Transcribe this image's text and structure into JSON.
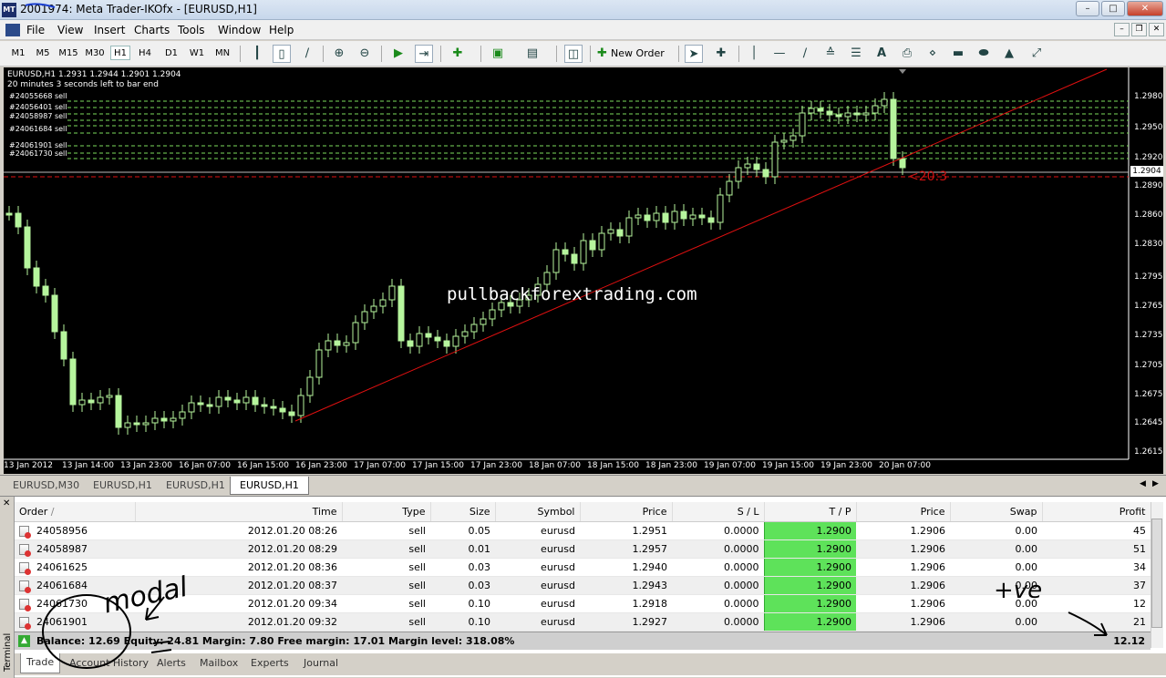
{
  "window": {
    "title": "2001974: Meta Trader-IKOfx - [EURUSD,H1]",
    "app_icon": "MT"
  },
  "menu": [
    "File",
    "View",
    "Insert",
    "Charts",
    "Tools",
    "Window",
    "Help"
  ],
  "toolbar": {
    "timeframes": [
      "M1",
      "M5",
      "M15",
      "M30",
      "H1",
      "H4",
      "D1",
      "W1",
      "MN"
    ],
    "active_timeframe": "H1",
    "new_order_label": "New Order",
    "icons": [
      "bar-chart-icon",
      "candle-chart-icon",
      "line-chart-icon",
      "zoom-in-icon",
      "zoom-out-icon",
      "autoscroll-icon",
      "chart-shift-icon",
      "indicators-icon",
      "templates-icon",
      "periods-icon",
      "navigator-icon",
      "new-order-icon",
      "cursor-icon",
      "crosshair-icon",
      "vertical-line-icon",
      "horizontal-line-icon",
      "trendline-icon",
      "channel-icon",
      "fibonacci-icon",
      "text-icon",
      "text-label-icon",
      "fibo-fan-icon",
      "rectangle-icon",
      "ellipse-icon",
      "triangle-icon",
      "arrows-icon"
    ]
  },
  "chart": {
    "info_line1": "EURUSD,H1  1.2931 1.2944 1.2901 1.2904",
    "info_line2": "20 minutes 3 seconds left to bar end",
    "order_labels": [
      "#24055668 sell",
      "#24056401 sell",
      "#24058987 sell",
      "#24061684 sell",
      "#24061901 sell",
      "#24061730 sell"
    ],
    "watermark": "pullbackforextrading.com",
    "cursor_label": "<20:3",
    "current_price": "1.2904",
    "price_ticks": [
      "1.2980",
      "1.2950",
      "1.2920",
      "1.2890",
      "1.2860",
      "1.2830",
      "1.2795",
      "1.2765",
      "1.2735",
      "1.2705",
      "1.2675",
      "1.2645",
      "1.2615"
    ],
    "time_ticks": [
      "13 Jan 2012",
      "13 Jan 14:00",
      "13 Jan 23:00",
      "16 Jan 07:00",
      "16 Jan 15:00",
      "16 Jan 23:00",
      "17 Jan 07:00",
      "17 Jan 15:00",
      "17 Jan 23:00",
      "18 Jan 07:00",
      "18 Jan 15:00",
      "18 Jan 23:00",
      "19 Jan 07:00",
      "19 Jan 15:00",
      "19 Jan 23:00",
      "20 Jan 07:00"
    ],
    "colors": {
      "background": "#000000",
      "candle": "#b6f59d",
      "trendline": "#e01010",
      "order_lines": "#7ddc5b",
      "stop_line": "#e01010"
    }
  },
  "chart_tabs": [
    "EURUSD,M30",
    "EURUSD,H1",
    "EURUSD,H1",
    "EURUSD,H1"
  ],
  "active_chart_tab": 3,
  "terminal": {
    "columns": [
      "Order",
      "Time",
      "Type",
      "Size",
      "Symbol",
      "Price",
      "S / L",
      "T / P",
      "Price",
      "Swap",
      "Profit"
    ],
    "rows": [
      [
        "24058956",
        "2012.01.20 08:26",
        "sell",
        "0.05",
        "eurusd",
        "1.2951",
        "0.0000",
        "1.2900",
        "1.2906",
        "0.00",
        "45"
      ],
      [
        "24058987",
        "2012.01.20 08:29",
        "sell",
        "0.01",
        "eurusd",
        "1.2957",
        "0.0000",
        "1.2900",
        "1.2906",
        "0.00",
        "51"
      ],
      [
        "24061625",
        "2012.01.20 08:36",
        "sell",
        "0.03",
        "eurusd",
        "1.2940",
        "0.0000",
        "1.2900",
        "1.2906",
        "0.00",
        "34"
      ],
      [
        "24061684",
        "2012.01.20 08:37",
        "sell",
        "0.03",
        "eurusd",
        "1.2943",
        "0.0000",
        "1.2900",
        "1.2906",
        "0.00",
        "37"
      ],
      [
        "24061730",
        "2012.01.20 09:34",
        "sell",
        "0.10",
        "eurusd",
        "1.2918",
        "0.0000",
        "1.2900",
        "1.2906",
        "0.00",
        "12"
      ],
      [
        "24061901",
        "2012.01.20 09:32",
        "sell",
        "0.10",
        "eurusd",
        "1.2927",
        "0.0000",
        "1.2900",
        "1.2906",
        "0.00",
        "21"
      ]
    ],
    "balance_text": "Balance: 12.69  Equity: 24.81  Margin: 7.80  Free margin: 17.01  Margin level: 318.08%",
    "total_profit": "12.12",
    "side_label": "Terminal",
    "tabs": [
      "Trade",
      "Account History",
      "Alerts",
      "Mailbox",
      "Experts",
      "Journal"
    ],
    "active_tab": "Trade"
  },
  "annotations": {
    "handwriting_left": "modal",
    "handwriting_right": "+ve"
  }
}
